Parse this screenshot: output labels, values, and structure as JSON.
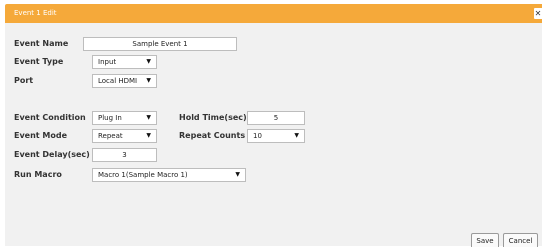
{
  "dialog": {
    "title": "Event 1 Edit",
    "close_label": "✕"
  },
  "form": {
    "event_name": {
      "label": "Event Name",
      "value": "Sample Event 1"
    },
    "event_type": {
      "label": "Event Type",
      "value": "Input"
    },
    "port": {
      "label": "Port",
      "value": "Local HDMI"
    },
    "event_condition": {
      "label": "Event Condition",
      "value": "Plug In"
    },
    "hold_time": {
      "label": "Hold Time(sec)",
      "value": "5"
    },
    "event_mode": {
      "label": "Event Mode",
      "value": "Repeat"
    },
    "repeat_counts": {
      "label": "Repeat Counts",
      "value": "10"
    },
    "event_delay": {
      "label": "Event Delay(sec)",
      "value": "3"
    },
    "run_macro": {
      "label": "Run Macro",
      "value": "Macro 1(Sample Macro 1)"
    }
  },
  "buttons": {
    "save": "Save",
    "cancel": "Cancel"
  },
  "icons": {
    "dropdown": "chevron-down-icon",
    "close": "close-icon"
  },
  "colors": {
    "title_bar": "#f5a93a",
    "panel": "#f1f1f1"
  }
}
